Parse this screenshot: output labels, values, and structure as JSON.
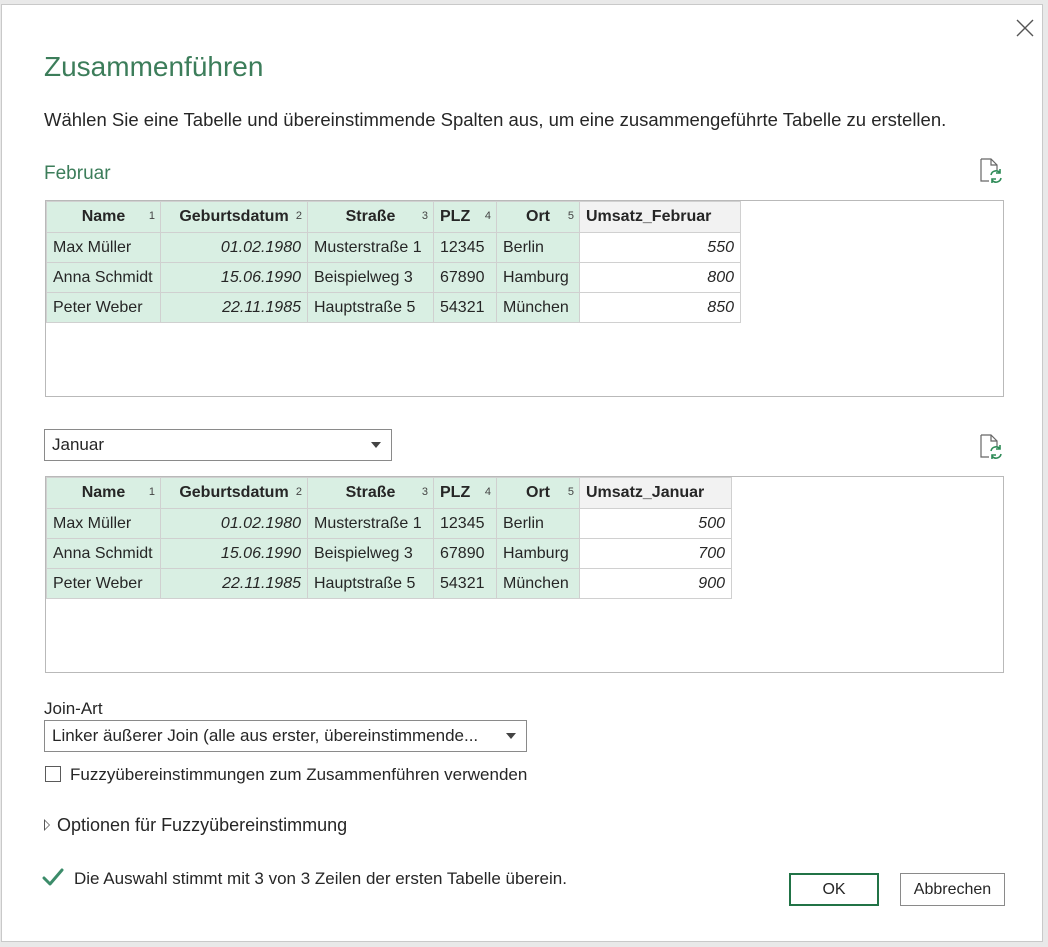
{
  "dialog": {
    "title": "Zusammenführen",
    "subtitle": "Wählen Sie eine Tabelle und übereinstimmende Spalten aus, um eine zusammengeführte Tabelle zu erstellen.",
    "close_icon": "close-icon"
  },
  "first_table": {
    "name": "Februar",
    "refresh_icon": "refresh-icon",
    "columns": [
      {
        "label": "Name",
        "index": "1",
        "selected": true
      },
      {
        "label": "Geburtsdatum",
        "index": "2",
        "selected": true
      },
      {
        "label": "Straße",
        "index": "3",
        "selected": true
      },
      {
        "label": "PLZ",
        "index": "4",
        "selected": true
      },
      {
        "label": "Ort",
        "index": "5",
        "selected": true
      },
      {
        "label": "Umsatz_Februar",
        "index": "",
        "selected": false
      }
    ],
    "rows": [
      [
        "Max Müller",
        "01.02.1980",
        "Musterstraße 1",
        "12345",
        "Berlin",
        "550"
      ],
      [
        "Anna Schmidt",
        "15.06.1990",
        "Beispielweg 3",
        "67890",
        "Hamburg",
        "800"
      ],
      [
        "Peter Weber",
        "22.11.1985",
        "Hauptstraße 5",
        "54321",
        "München",
        "850"
      ]
    ]
  },
  "second_table": {
    "selected": "Januar",
    "refresh_icon": "refresh-icon",
    "columns": [
      {
        "label": "Name",
        "index": "1",
        "selected": true
      },
      {
        "label": "Geburtsdatum",
        "index": "2",
        "selected": true
      },
      {
        "label": "Straße",
        "index": "3",
        "selected": true
      },
      {
        "label": "PLZ",
        "index": "4",
        "selected": true
      },
      {
        "label": "Ort",
        "index": "5",
        "selected": true
      },
      {
        "label": "Umsatz_Januar",
        "index": "",
        "selected": false
      }
    ],
    "rows": [
      [
        "Max Müller",
        "01.02.1980",
        "Musterstraße 1",
        "12345",
        "Berlin",
        "500"
      ],
      [
        "Anna Schmidt",
        "15.06.1990",
        "Beispielweg 3",
        "67890",
        "Hamburg",
        "700"
      ],
      [
        "Peter Weber",
        "22.11.1985",
        "Hauptstraße 5",
        "54321",
        "München",
        "900"
      ]
    ]
  },
  "join": {
    "label": "Join-Art",
    "selected": "Linker äußerer Join (alle aus erster, übereinstimmende..."
  },
  "fuzzy": {
    "checkbox_label": "Fuzzyübereinstimmungen zum Zusammenführen verwenden",
    "checked": false,
    "options_label": "Optionen für Fuzzyübereinstimmung"
  },
  "status": {
    "text": "Die Auswahl stimmt mit 3 von 3 Zeilen der ersten Tabelle überein.",
    "icon": "checkmark-icon",
    "color": "#3c8c6a"
  },
  "buttons": {
    "ok": "OK",
    "cancel": "Abbrechen"
  },
  "colors": {
    "accent": "#3c7d5a",
    "selected_column": "#d9efe3",
    "ok_border": "#217346"
  }
}
